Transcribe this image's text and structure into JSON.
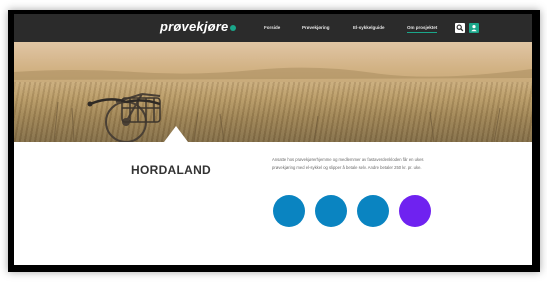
{
  "nav": {
    "logo": "prøvekjøre",
    "items": [
      {
        "label": "Forside",
        "active": false
      },
      {
        "label": "Prøvekjøring",
        "active": false
      },
      {
        "label": "El-sykkelguide",
        "active": false
      },
      {
        "label": "Om prosjektet",
        "active": true
      }
    ],
    "search_icon": "search-icon",
    "user_icon": "user-icon"
  },
  "region": {
    "title": "HORDALAND"
  },
  "intro": {
    "line1": "Ansatte hos prøvekjørerhjemme og medlemmer av fastaverdenkloden får en ukes",
    "line2": "prøvekjøring med el-sykkel og slipper å betale selv. Andre betaler 250 kr. pr. uke."
  },
  "circles": [
    {
      "name": "circle-1",
      "color": "#0a84c1"
    },
    {
      "name": "circle-2",
      "color": "#0a84c1"
    },
    {
      "name": "circle-3",
      "color": "#0a84c1"
    },
    {
      "name": "circle-4",
      "color": "#6f22f0"
    }
  ],
  "colors": {
    "nav_bg": "#2b2b2b",
    "accent": "#1aa68a",
    "circle_blue": "#0a84c1",
    "circle_purple": "#6f22f0"
  }
}
